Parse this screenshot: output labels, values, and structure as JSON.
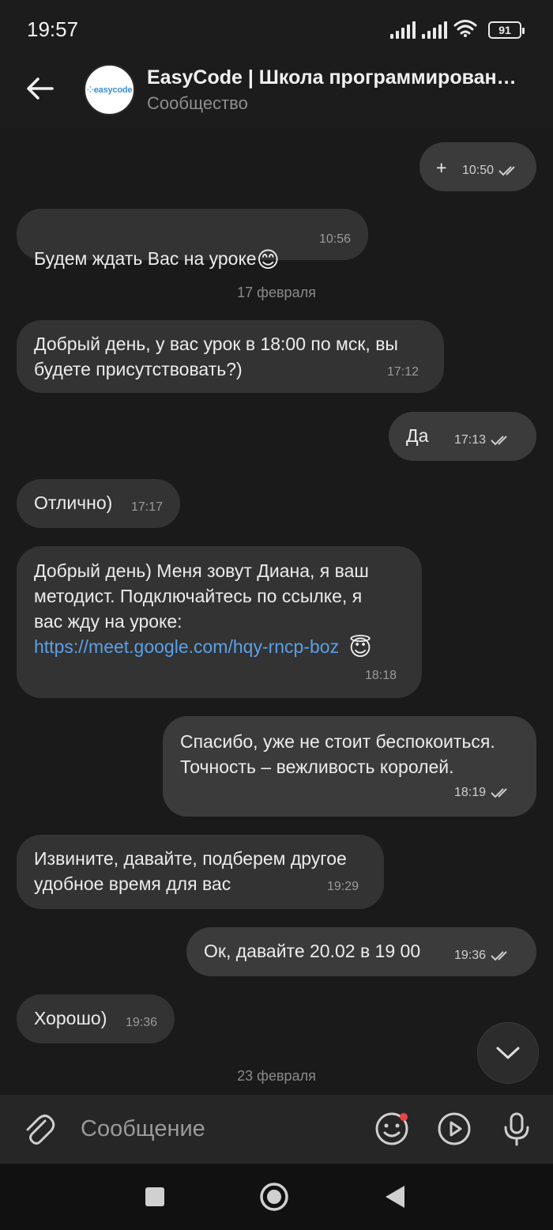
{
  "status": {
    "time": "19:57",
    "battery": "91"
  },
  "header": {
    "title": "EasyCode | Школа программирован…",
    "subtitle": "Сообщество",
    "avatar_text": "easycode"
  },
  "messages": [
    {
      "direction": "out",
      "text": "+",
      "time": "10:50",
      "read": true
    },
    {
      "direction": "in",
      "text": "Будем ждать Вас на уроке",
      "emoji": "😊",
      "time": "10:56"
    },
    {
      "direction": "in",
      "text": "Добрый день, у вас урок в 18:00 по мск, вы\nбудете присутствовать?)",
      "time": "17:12"
    },
    {
      "direction": "out",
      "text": "Да",
      "time": "17:13",
      "read": true
    },
    {
      "direction": "in",
      "text": "Отлично)",
      "time": "17:17"
    },
    {
      "direction": "in",
      "text": "Добрый день) Меня зовут Диана, я ваш\nметодист. Подключайтесь по ссылке, я\nвас жду на уроке:",
      "link": "https://meet.google.com/hqy-rncp-boz",
      "emoji": "😇",
      "time": "18:18"
    },
    {
      "direction": "out",
      "text": "Спасибо, уже не стоит беспокоиться.\nТочность – вежливость королей.",
      "time": "18:19",
      "read": true
    },
    {
      "direction": "in",
      "text": "Извините, давайте, подберем другое\nудобное время для вас",
      "time": "19:29"
    },
    {
      "direction": "out",
      "text": "Ок, давайте 20.02 в 19 00",
      "time": "19:36",
      "read": true
    },
    {
      "direction": "in",
      "text": "Хорошо)",
      "time": "19:36"
    }
  ],
  "date_separators": [
    "17 февраля",
    "23 февраля"
  ],
  "composer": {
    "placeholder": "Сообщение"
  },
  "colors": {
    "background": "#1a1a1a",
    "bubble_in": "#333333",
    "bubble_out": "#3b3b3b",
    "link": "#5aa0e8",
    "notification_dot": "#e64646"
  }
}
